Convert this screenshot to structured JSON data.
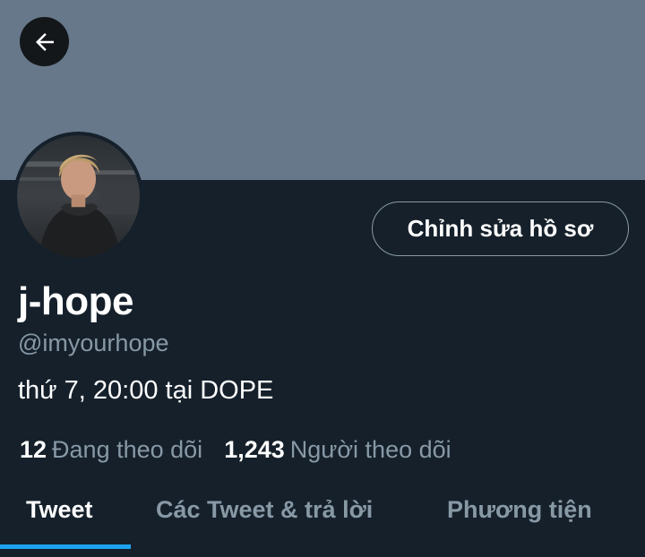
{
  "profile": {
    "display_name": "j-hope",
    "handle": "@imyourhope",
    "bio": "thứ 7, 20:00 tại DOPE",
    "edit_profile_label": "Chỉnh sửa hồ sơ"
  },
  "stats": {
    "following_count": "12",
    "following_label": "Đang theo dõi",
    "followers_count": "1,243",
    "followers_label": "Người theo dõi"
  },
  "tabs": [
    {
      "label": "Tweet",
      "active": true
    },
    {
      "label": "Các Tweet & trả lời",
      "active": false
    },
    {
      "label": "Phương tiện",
      "active": false
    }
  ],
  "colors": {
    "background": "#15202b",
    "banner": "#66788a",
    "accent": "#1da1f2",
    "secondary_text": "#8899a6"
  },
  "icons": {
    "back": "arrow-left-icon"
  }
}
